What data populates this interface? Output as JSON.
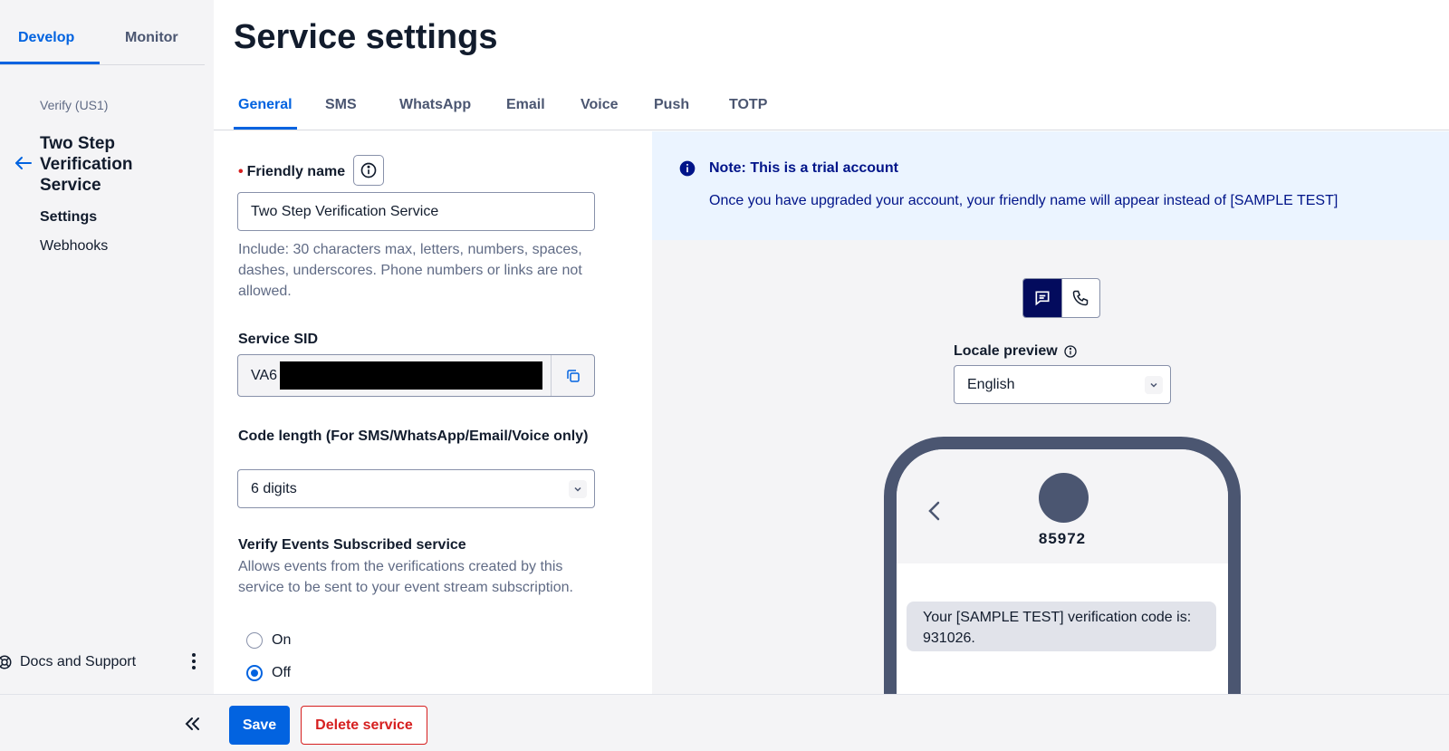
{
  "sidebar": {
    "tabs": [
      {
        "label": "Develop",
        "active": true
      },
      {
        "label": "Monitor",
        "active": false
      }
    ],
    "breadcrumb": "Verify (US1)",
    "service_name": "Two Step Verification Service",
    "nav": [
      {
        "label": "Settings",
        "active": true
      },
      {
        "label": "Webhooks",
        "active": false
      }
    ],
    "docs_label": "Docs and Support",
    "icons": {
      "back": "arrow-left-icon",
      "docs": "lifebuoy-icon",
      "more": "kebab-icon",
      "collapse": "double-chevron-left-icon"
    }
  },
  "header": {
    "title": "Service settings",
    "tabs": [
      "General",
      "SMS",
      "WhatsApp",
      "Email",
      "Voice",
      "Push",
      "TOTP"
    ],
    "active_tab": "General"
  },
  "form": {
    "friendly_name": {
      "label": "Friendly name",
      "required": true,
      "value": "Two Step Verification Service",
      "help": "Include: 30 characters max, letters, numbers, spaces, dashes, underscores. Phone numbers or links are not allowed."
    },
    "service_sid": {
      "label": "Service SID",
      "value_visible": "VA6"
    },
    "code_length": {
      "label": "Code length (For SMS/WhatsApp/Email/Voice only)",
      "value": "6 digits"
    },
    "verify_events": {
      "label": "Verify Events Subscribed service",
      "help": "Allows events from the verifications created by this service to be sent to your event stream subscription.",
      "options": [
        "On",
        "Off"
      ],
      "selected": "Off"
    }
  },
  "preview": {
    "note": {
      "title": "Note: This is a trial account",
      "body": "Once you have upgraded your account, your friendly name will appear instead of [SAMPLE TEST]"
    },
    "channel_toggle": {
      "options": [
        "sms-icon",
        "phone-icon"
      ],
      "active": "sms-icon"
    },
    "locale": {
      "label": "Locale preview",
      "value": "English"
    },
    "phone": {
      "sender": "85972",
      "message": "Your [SAMPLE TEST] verification code is: 931026."
    }
  },
  "footer": {
    "save_label": "Save",
    "delete_label": "Delete service"
  },
  "colors": {
    "primary": "#0263e0",
    "destructive": "#d61f1f",
    "note_bg": "#ebf4ff",
    "note_text": "#001489",
    "toggle_active": "#030b5d",
    "phone_frame": "#4b5671"
  }
}
